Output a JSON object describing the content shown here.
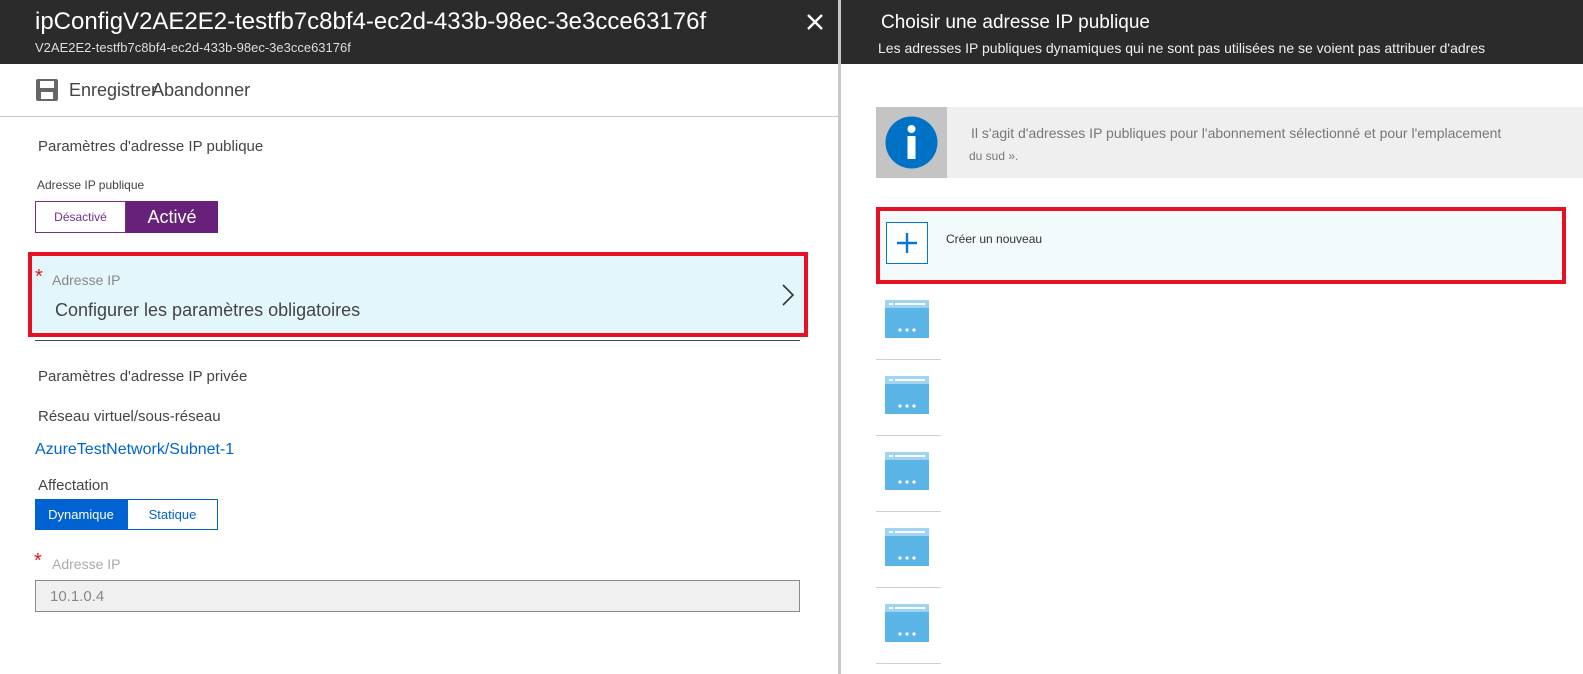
{
  "left_blade": {
    "title": "ipConfigV2AE2E2-testfb7c8bf4-ec2d-433b-98ec-3e3cce63176f",
    "subtitle": "V2AE2E2-testfb7c8bf4-ec2d-433b-98ec-3e3cce63176f",
    "toolbar": {
      "save_label": "Enregistrer",
      "discard_label": "Abandonner"
    },
    "public_ip_section": {
      "heading": "Paramètres d'adresse IP publique",
      "toggle_label": "Adresse IP publique",
      "toggle_off": "Désactivé",
      "toggle_on": "Activé",
      "selected": "Activé"
    },
    "ip_address_selector": {
      "required_mark": "*",
      "label": "Adresse IP",
      "value": "Configurer les paramètres obligatoires"
    },
    "private_ip_section": {
      "heading": "Paramètres d'adresse IP privée",
      "vnet_label": "Réseau virtuel/sous-réseau",
      "vnet_value": "AzureTestNetwork/Subnet-1",
      "assignment_label": "Affectation",
      "assignment_dynamic": "Dynamique",
      "assignment_static": "Statique",
      "selected": "Dynamique",
      "ip_required_mark": "*",
      "ip_label": "Adresse IP",
      "ip_value": "10.1.0.4"
    }
  },
  "right_blade": {
    "title": "Choisir une adresse IP publique",
    "subtitle": "Les adresses IP publiques dynamiques qui ne sont pas utilisées ne se voient pas attribuer d'adres",
    "info": {
      "line1": "Il s'agit d'adresses IP publiques pour l'abonnement sélectionné et pour l'emplacement",
      "line2": "du sud »."
    },
    "create_new_label": "Créer un nouveau",
    "ip_item_count": 5
  },
  "colors": {
    "header_bg": "#2b2b2b",
    "highlight_red": "#e81123",
    "purple_toggle": "#68217a",
    "blue_toggle": "#0063d1",
    "selector_bg": "#e2f6fb",
    "link_blue": "#0063d1"
  },
  "icons": [
    "close-icon",
    "save-icon",
    "chevron-right-icon",
    "info-icon",
    "plus-icon",
    "public-ip-icon"
  ]
}
